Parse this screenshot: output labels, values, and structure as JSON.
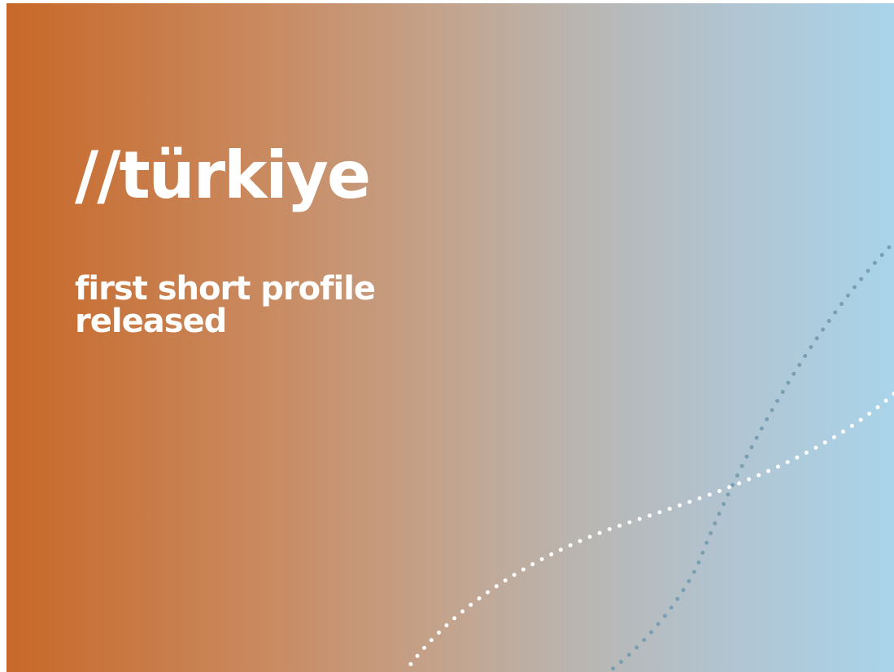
{
  "banner": {
    "title": "//türkiye",
    "subtitle_lines": [
      "first short profile",
      "released"
    ]
  },
  "colors": {
    "gradient_start": "#c86828",
    "gradient_end": "#a9d4ea",
    "text": "#ffffff",
    "dots_light": "#ffffff",
    "dots_dark": "#7a9fb2"
  }
}
